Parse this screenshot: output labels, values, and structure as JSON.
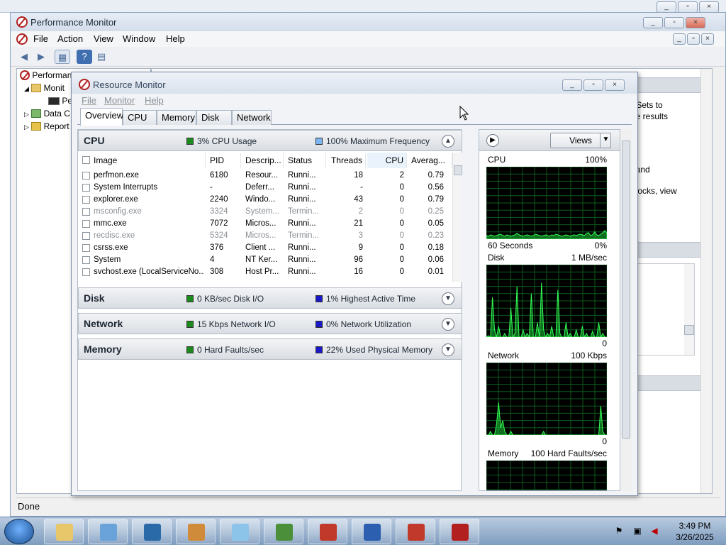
{
  "outer_window": {
    "buttons": [
      "_",
      "▫",
      "×"
    ]
  },
  "perfmon": {
    "title": "Performance Monitor",
    "menu": [
      "File",
      "Action",
      "View",
      "Window",
      "Help"
    ],
    "tree": [
      {
        "label": "Performan",
        "level": 0
      },
      {
        "label": "Monit",
        "level": 1
      },
      {
        "label": "Per",
        "level": 2
      },
      {
        "label": "Data C",
        "level": 1
      },
      {
        "label": "Report",
        "level": 1
      }
    ],
    "right_text_1": "r Sets to",
    "right_text_2": "he results",
    "right_text_3": ", and",
    "right_text_4": "g",
    "right_text_5": "dlocks, view",
    "right_text_6": "it",
    "status": "Done"
  },
  "resmon": {
    "title": "Resource Monitor",
    "menu": [
      "File",
      "Monitor",
      "Help"
    ],
    "tabs": [
      "Overview",
      "CPU",
      "Memory",
      "Disk",
      "Network"
    ],
    "active_tab": "Overview",
    "sections": {
      "cpu": {
        "title": "CPU",
        "ind1": "3% CPU Usage",
        "ind2": "100% Maximum Frequency",
        "ind1_color": "#1c8a1c",
        "ind2_color": "#7cb6f2"
      },
      "disk": {
        "title": "Disk",
        "ind1": "0 KB/sec Disk I/O",
        "ind2": "1% Highest Active Time",
        "ind1_color": "#1c8a1c",
        "ind2_color": "#1919c8"
      },
      "network": {
        "title": "Network",
        "ind1": "15 Kbps Network I/O",
        "ind2": "0% Network Utilization",
        "ind1_color": "#1c8a1c",
        "ind2_color": "#1919c8"
      },
      "memory": {
        "title": "Memory",
        "ind1": "0 Hard Faults/sec",
        "ind2": "22% Used Physical Memory",
        "ind1_color": "#1c8a1c",
        "ind2_color": "#1919c8"
      }
    },
    "cpu_table": {
      "headers": [
        "Image",
        "PID",
        "Descrip...",
        "Status",
        "Threads",
        "CPU",
        "Averag..."
      ],
      "rows": [
        {
          "image": "perfmon.exe",
          "pid": "6180",
          "desc": "Resour...",
          "status": "Runni...",
          "threads": "18",
          "cpu": "2",
          "avg": "0.79",
          "ended": false
        },
        {
          "image": "System Interrupts",
          "pid": "-",
          "desc": "Deferr...",
          "status": "Runni...",
          "threads": "-",
          "cpu": "0",
          "avg": "0.56",
          "ended": false
        },
        {
          "image": "explorer.exe",
          "pid": "2240",
          "desc": "Windo...",
          "status": "Runni...",
          "threads": "43",
          "cpu": "0",
          "avg": "0.79",
          "ended": false
        },
        {
          "image": "msconfig.exe",
          "pid": "3324",
          "desc": "System...",
          "status": "Termin...",
          "threads": "2",
          "cpu": "0",
          "avg": "0.25",
          "ended": true
        },
        {
          "image": "mmc.exe",
          "pid": "7072",
          "desc": "Micros...",
          "status": "Runni...",
          "threads": "21",
          "cpu": "0",
          "avg": "0.05",
          "ended": false
        },
        {
          "image": "recdisc.exe",
          "pid": "5324",
          "desc": "Micros...",
          "status": "Termin...",
          "threads": "3",
          "cpu": "0",
          "avg": "0.23",
          "ended": true
        },
        {
          "image": "csrss.exe",
          "pid": "376",
          "desc": "Client ...",
          "status": "Runni...",
          "threads": "9",
          "cpu": "0",
          "avg": "0.18",
          "ended": false
        },
        {
          "image": "System",
          "pid": "4",
          "desc": "NT Ker...",
          "status": "Runni...",
          "threads": "96",
          "cpu": "0",
          "avg": "0.06",
          "ended": false
        },
        {
          "image": "svchost.exe (LocalServiceNo...",
          "pid": "308",
          "desc": "Host Pr...",
          "status": "Runni...",
          "threads": "16",
          "cpu": "0",
          "avg": "0.01",
          "ended": false
        }
      ]
    },
    "views_label": "Views",
    "graphs": [
      {
        "name": "CPU",
        "max": "100%",
        "bottom_left": "60 Seconds",
        "bottom_right": "0%",
        "values": [
          5,
          4,
          6,
          5,
          4,
          5,
          6,
          7,
          5,
          4,
          6,
          5,
          4,
          5,
          6,
          8,
          6,
          5,
          4,
          5,
          6,
          5,
          4,
          5,
          7,
          6,
          5,
          4,
          5,
          6,
          5,
          4,
          6,
          5,
          7,
          6,
          5,
          4,
          5,
          6,
          5,
          4,
          5,
          6,
          5,
          6,
          7,
          6,
          5,
          8,
          9,
          5,
          6,
          10,
          6,
          5,
          7,
          9,
          12,
          8
        ]
      },
      {
        "name": "Disk",
        "max": "1 MB/sec",
        "bottom_left": "",
        "bottom_right": "0",
        "values": [
          0,
          2,
          0,
          55,
          10,
          0,
          15,
          0,
          0,
          5,
          0,
          0,
          40,
          0,
          5,
          70,
          0,
          0,
          10,
          0,
          5,
          0,
          60,
          0,
          0,
          20,
          0,
          75,
          10,
          0,
          5,
          0,
          15,
          0,
          0,
          65,
          5,
          0,
          0,
          20,
          0,
          5,
          0,
          0,
          10,
          0,
          0,
          15,
          0,
          5,
          0,
          0,
          8,
          0,
          0,
          20,
          0,
          5,
          0,
          0
        ]
      },
      {
        "name": "Network",
        "max": "100 Kbps",
        "bottom_left": "",
        "bottom_right": "0",
        "values": [
          0,
          0,
          5,
          0,
          0,
          15,
          45,
          10,
          20,
          5,
          0,
          0,
          5,
          0,
          0,
          0,
          0,
          0,
          0,
          0,
          0,
          0,
          0,
          0,
          0,
          0,
          0,
          0,
          5,
          0,
          0,
          0,
          0,
          0,
          0,
          0,
          0,
          0,
          0,
          0,
          0,
          0,
          0,
          0,
          0,
          0,
          0,
          0,
          0,
          0,
          0,
          0,
          0,
          0,
          0,
          0,
          40,
          5,
          0,
          0
        ]
      },
      {
        "name": "Memory",
        "max": "100 Hard Faults/sec",
        "bottom_left": "",
        "bottom_right": "",
        "values": []
      }
    ]
  },
  "taskbar": {
    "clock_time": "3:49 PM",
    "clock_date": "3/26/2025",
    "apps": [
      {
        "name": "explorer-folder-icon",
        "color": "#e8c66a"
      },
      {
        "name": "control-panel-icon",
        "color": "#6aa3d9"
      },
      {
        "name": "network-diagnostic-icon",
        "color": "#2b6aa9"
      },
      {
        "name": "paint-icon",
        "color": "#d08b3a"
      },
      {
        "name": "notepad-icon",
        "color": "#8bc4e8"
      },
      {
        "name": "computer-management-icon",
        "color": "#4b8f3a"
      },
      {
        "name": "toolbox-icon",
        "color": "#c0392b"
      },
      {
        "name": "remote-desktop-icon",
        "color": "#2d5fb0"
      },
      {
        "name": "toolbox-icon-2",
        "color": "#c0392b"
      },
      {
        "name": "performance-monitor-icon",
        "color": "#b32020"
      }
    ]
  }
}
